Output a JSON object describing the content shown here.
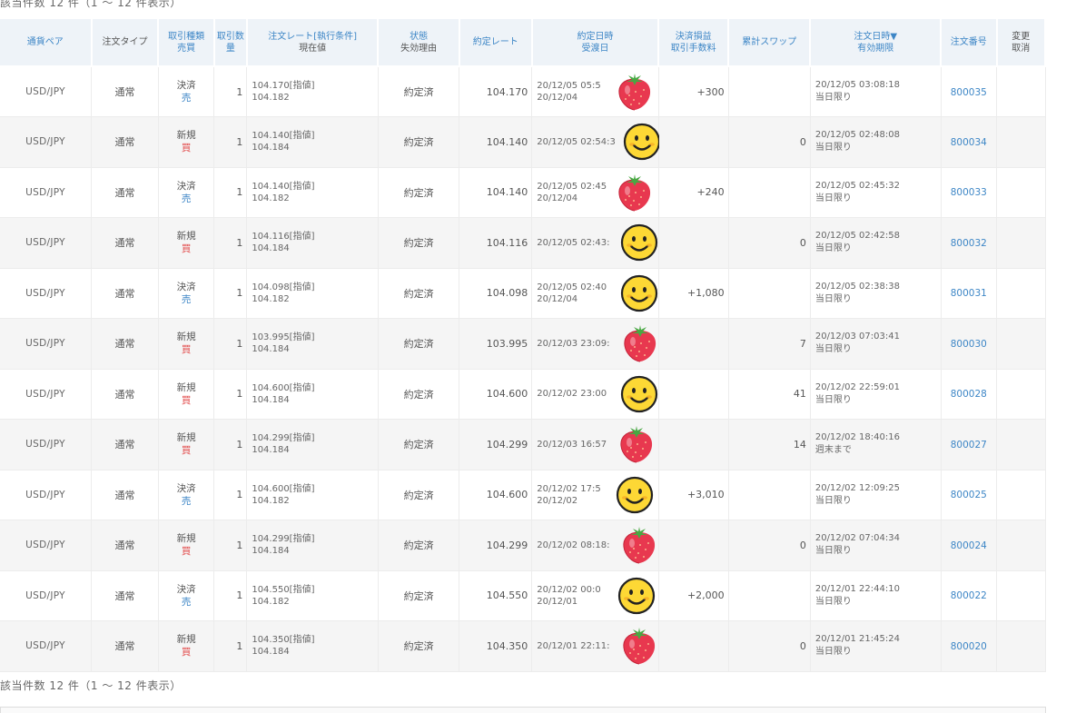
{
  "summary_top": "該当件数 12 件（1 ～ 12 件表示）",
  "summary_bottom": "該当件数 12 件（1 ～ 12 件表示）",
  "columns": {
    "pair": "通貨ペア",
    "order_type": "注文タイプ",
    "trade_kind_line1": "取引種類",
    "trade_kind_line2": "売買",
    "quantity": "取引数量",
    "rate_line1": "注文レート[執行条件]",
    "rate_line2": "現在値",
    "status_line1": "状態",
    "status_line2": "失効理由",
    "exec_rate": "約定レート",
    "exec_dt_line1": "約定日時",
    "exec_dt_line2": "受渡日",
    "pl_line1": "決済損益",
    "pl_line2": "取引手数料",
    "swap": "累計スワップ",
    "ordered_line1": "注文日時▼",
    "ordered_line2": "有効期限",
    "order_no": "注文番号",
    "cancel_line1": "変更",
    "cancel_line2": "取消"
  },
  "rows": [
    {
      "pair": "USD/JPY",
      "order_type": "通常",
      "trade": "決済",
      "side": "売",
      "side_kind": "sell",
      "qty": "1",
      "rate": "104.170[指値]",
      "current": "104.182",
      "status": "約定済",
      "exec_rate": "104.170",
      "exec_dt": "20/12/05 05:5",
      "delivery": "20/12/04",
      "pl": "+300",
      "swap": "",
      "ordered": "20/12/05 03:08:18",
      "expiry": "当日限り",
      "order_no": "800035",
      "sticker": "strawberry"
    },
    {
      "pair": "USD/JPY",
      "order_type": "通常",
      "trade": "新規",
      "side": "買",
      "side_kind": "buy",
      "qty": "1",
      "rate": "104.140[指値]",
      "current": "104.184",
      "status": "約定済",
      "exec_rate": "104.140",
      "exec_dt": "20/12/05 02:54:3",
      "delivery": "",
      "pl": "",
      "swap": "0",
      "ordered": "20/12/05 02:48:08",
      "expiry": "当日限り",
      "order_no": "800034",
      "sticker": "smiley"
    },
    {
      "pair": "USD/JPY",
      "order_type": "通常",
      "trade": "決済",
      "side": "売",
      "side_kind": "sell",
      "qty": "1",
      "rate": "104.140[指値]",
      "current": "104.182",
      "status": "約定済",
      "exec_rate": "104.140",
      "exec_dt": "20/12/05 02:45",
      "delivery": "20/12/04",
      "pl": "+240",
      "swap": "",
      "ordered": "20/12/05 02:45:32",
      "expiry": "当日限り",
      "order_no": "800033",
      "sticker": "strawberry"
    },
    {
      "pair": "USD/JPY",
      "order_type": "通常",
      "trade": "新規",
      "side": "買",
      "side_kind": "buy",
      "qty": "1",
      "rate": "104.116[指値]",
      "current": "104.184",
      "status": "約定済",
      "exec_rate": "104.116",
      "exec_dt": "20/12/05 02:43:",
      "delivery": "",
      "pl": "",
      "swap": "0",
      "ordered": "20/12/05 02:42:58",
      "expiry": "当日限り",
      "order_no": "800032",
      "sticker": "smiley"
    },
    {
      "pair": "USD/JPY",
      "order_type": "通常",
      "trade": "決済",
      "side": "売",
      "side_kind": "sell",
      "qty": "1",
      "rate": "104.098[指値]",
      "current": "104.182",
      "status": "約定済",
      "exec_rate": "104.098",
      "exec_dt": "20/12/05 02:40",
      "delivery": "20/12/04",
      "pl": "+1,080",
      "swap": "",
      "ordered": "20/12/05 02:38:38",
      "expiry": "当日限り",
      "order_no": "800031",
      "sticker": "smiley"
    },
    {
      "pair": "USD/JPY",
      "order_type": "通常",
      "trade": "新規",
      "side": "買",
      "side_kind": "buy",
      "qty": "1",
      "rate": "103.995[指値]",
      "current": "104.184",
      "status": "約定済",
      "exec_rate": "103.995",
      "exec_dt": "20/12/03 23:09:",
      "delivery": "",
      "pl": "",
      "swap": "7",
      "ordered": "20/12/03 07:03:41",
      "expiry": "当日限り",
      "order_no": "800030",
      "sticker": "strawberry"
    },
    {
      "pair": "USD/JPY",
      "order_type": "通常",
      "trade": "新規",
      "side": "買",
      "side_kind": "buy",
      "qty": "1",
      "rate": "104.600[指値]",
      "current": "104.184",
      "status": "約定済",
      "exec_rate": "104.600",
      "exec_dt": "20/12/02 23:00",
      "delivery": "",
      "pl": "",
      "swap": "41",
      "ordered": "20/12/02 22:59:01",
      "expiry": "当日限り",
      "order_no": "800028",
      "sticker": "smiley"
    },
    {
      "pair": "USD/JPY",
      "order_type": "通常",
      "trade": "新規",
      "side": "買",
      "side_kind": "buy",
      "qty": "1",
      "rate": "104.299[指値]",
      "current": "104.184",
      "status": "約定済",
      "exec_rate": "104.299",
      "exec_dt": "20/12/03 16:57",
      "delivery": "",
      "pl": "",
      "swap": "14",
      "ordered": "20/12/02 18:40:16",
      "expiry": "週末まで",
      "order_no": "800027",
      "sticker": "strawberry"
    },
    {
      "pair": "USD/JPY",
      "order_type": "通常",
      "trade": "決済",
      "side": "売",
      "side_kind": "sell",
      "qty": "1",
      "rate": "104.600[指値]",
      "current": "104.182",
      "status": "約定済",
      "exec_rate": "104.600",
      "exec_dt": "20/12/02 17:5",
      "delivery": "20/12/02",
      "pl": "+3,010",
      "swap": "",
      "ordered": "20/12/02 12:09:25",
      "expiry": "当日限り",
      "order_no": "800025",
      "sticker": "smiley"
    },
    {
      "pair": "USD/JPY",
      "order_type": "通常",
      "trade": "新規",
      "side": "買",
      "side_kind": "buy",
      "qty": "1",
      "rate": "104.299[指値]",
      "current": "104.184",
      "status": "約定済",
      "exec_rate": "104.299",
      "exec_dt": "20/12/02 08:18:",
      "delivery": "",
      "pl": "",
      "swap": "0",
      "ordered": "20/12/02 07:04:34",
      "expiry": "当日限り",
      "order_no": "800024",
      "sticker": "strawberry"
    },
    {
      "pair": "USD/JPY",
      "order_type": "通常",
      "trade": "決済",
      "side": "売",
      "side_kind": "sell",
      "qty": "1",
      "rate": "104.550[指値]",
      "current": "104.182",
      "status": "約定済",
      "exec_rate": "104.550",
      "exec_dt": "20/12/02 00:0",
      "delivery": "20/12/01",
      "pl": "+2,000",
      "swap": "",
      "ordered": "20/12/01 22:44:10",
      "expiry": "当日限り",
      "order_no": "800022",
      "sticker": "smiley"
    },
    {
      "pair": "USD/JPY",
      "order_type": "通常",
      "trade": "新規",
      "side": "買",
      "side_kind": "buy",
      "qty": "1",
      "rate": "104.350[指値]",
      "current": "104.184",
      "status": "約定済",
      "exec_rate": "104.350",
      "exec_dt": "20/12/01 22:11:",
      "delivery": "",
      "pl": "",
      "swap": "0",
      "ordered": "20/12/01 21:45:24",
      "expiry": "当日限り",
      "order_no": "800020",
      "sticker": "strawberry"
    }
  ],
  "colors": {
    "header_bg": "#eef3f8",
    "header_text": "#3d86c6",
    "buy": "#e24a4a",
    "sell": "#3d86c6",
    "link": "#3d86c6",
    "row_alt": "#f5f5f5"
  }
}
